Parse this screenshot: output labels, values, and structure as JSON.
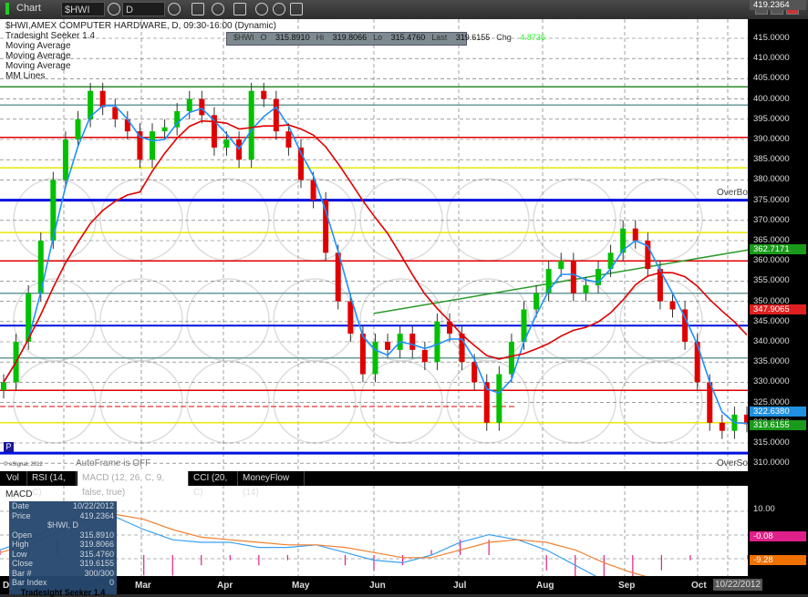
{
  "toolbar": {
    "title": "Chart",
    "symbol": "$HWI",
    "interval": "D"
  },
  "legend": {
    "line1": "$HWI,AMEX COMPUTER HARDWARE, D, 09:30-16:00 (Dynamic)",
    "line2": "Tradesight Seeker 1.4",
    "line3": "Moving Average",
    "line4": "Moving Average",
    "line5": "Moving Average",
    "line6": "MM Lines"
  },
  "quote": {
    "sym": "$HWI",
    "o_l": "O",
    "o": "315.8910",
    "h_l": "Hi",
    "h": "319.8066",
    "l_l": "Lo",
    "l": "315.4760",
    "c_l": "Last",
    "c": "319.6155",
    "chg_l": "Chg",
    "chg": "4.8736"
  },
  "labels": {
    "overbought": "OverBought (F",
    "oversold": "OverSold (Fran",
    "copyright": "© eSignal, 2012",
    "autoframe": "AutoFrame is OFF",
    "p": "P",
    "macd": "MACD"
  },
  "tabs": [
    {
      "label": "Vol"
    },
    {
      "label": "RSI (14, C)"
    },
    {
      "label": "MACD (12, 26, C, 9, false, true)"
    },
    {
      "label": "CCI (20, C)"
    },
    {
      "label": "MoneyFlow (14)"
    }
  ],
  "data_window": {
    "date_l": "Date",
    "date": "10/22/2012",
    "price_l": "Price",
    "price": "419.2364",
    "title": "$HWI, D",
    "open_l": "Open",
    "open": "315.8910",
    "high_l": "High",
    "high": "319.8066",
    "low_l": "Low",
    "low": "315.4760",
    "close_l": "Close",
    "close": "319.6155",
    "bar_l": "Bar #",
    "bar": "300/300",
    "idx_l": "Bar Index",
    "idx": "0",
    "footer": "Tradesight Seeker 1.4"
  },
  "price_axis": {
    "top": "419.2364",
    "ticks": [
      "415.0000",
      "410.0000",
      "405.0000",
      "400.0000",
      "395.0000",
      "390.0000",
      "385.0000",
      "380.0000",
      "375.0000",
      "370.0000",
      "365.0000",
      "360.0000",
      "355.0000",
      "350.0000",
      "345.0000",
      "340.0000",
      "335.0000",
      "330.0000",
      "325.0000",
      "320.0000",
      "315.0000",
      "310.0000"
    ],
    "tags": {
      "ma_long": "362.7171",
      "ma_red": "347.9065",
      "ma_blue": "322.6380",
      "last": "319.6155"
    },
    "macd_ticks": {
      "t1": "10.00",
      "hist": "-0.08",
      "signal": "-9.28"
    }
  },
  "x_axis": {
    "months": [
      "Dy",
      "Mar",
      "Apr",
      "May",
      "Jun",
      "Jul",
      "Aug",
      "Sep",
      "Oct"
    ],
    "date": "10/22/2012"
  },
  "colors": {
    "up": "#00c000",
    "down": "#e00000",
    "fast_ma": "#1e90ff",
    "slow_ma": "#e00000"
  },
  "chart_data": {
    "type": "candlestick",
    "ylim": [
      310,
      415
    ],
    "closes": [
      330,
      340,
      352,
      365,
      380,
      390,
      395,
      402,
      398,
      395,
      392,
      385,
      392,
      393,
      397,
      400,
      396,
      388,
      390,
      385,
      402,
      400,
      392,
      388,
      380,
      375,
      362,
      350,
      342,
      332,
      340,
      338,
      342,
      338,
      335,
      345,
      342,
      335,
      330,
      320,
      332,
      340,
      348,
      352,
      358,
      360,
      352,
      354,
      358,
      362,
      368,
      365,
      358,
      350,
      348,
      340,
      330,
      320,
      318,
      322,
      319.6155
    ],
    "hlines": [
      {
        "p": 403,
        "c": "#2e8b2e"
      },
      {
        "p": 398.5,
        "c": "#6a9a9a"
      },
      {
        "p": 390.5,
        "c": "#e00000"
      },
      {
        "p": 383,
        "c": "#e8e800"
      },
      {
        "p": 375,
        "c": "#0010e0",
        "w": 3
      },
      {
        "p": 367,
        "c": "#e8e800"
      },
      {
        "p": 360,
        "c": "#e00000"
      },
      {
        "p": 352,
        "c": "#6a9a9a"
      },
      {
        "p": 344,
        "c": "#0010e0",
        "w": 2
      },
      {
        "p": 336,
        "c": "#6a9a9a"
      },
      {
        "p": 328,
        "c": "#e00000"
      },
      {
        "p": 320,
        "c": "#e8e800"
      },
      {
        "p": 312.5,
        "c": "#0010e0",
        "w": 3
      }
    ],
    "macd": {
      "macd": [
        2,
        6,
        12,
        16,
        15,
        10,
        6,
        5,
        5,
        3,
        3,
        4,
        1,
        -2,
        -3,
        0,
        5,
        8,
        6,
        2,
        -4,
        -10,
        -12,
        -13,
        -12,
        -10,
        -10
      ],
      "signal": [
        1,
        4,
        9,
        14,
        16,
        14,
        10,
        7,
        6,
        5,
        4,
        4,
        3,
        1,
        -1,
        -1,
        2,
        5,
        6,
        5,
        2,
        -3,
        -7,
        -10,
        -11,
        -10,
        -9.28
      ]
    }
  }
}
